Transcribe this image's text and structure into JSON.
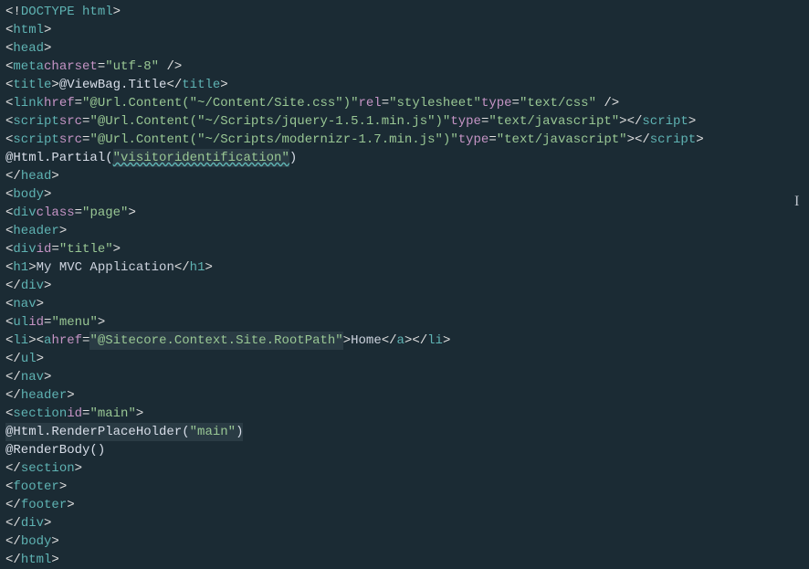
{
  "lines": {
    "l1": {
      "doctype": "<!DOCTYPE html>"
    },
    "l2": {
      "open_html": "<html>"
    },
    "l3": {
      "open_head": "<head>"
    },
    "l4": {
      "meta_open": "<",
      "meta_tag": "meta",
      "meta_sp": " ",
      "charset_attr": "charset",
      "eq": "=",
      "charset_val": "\"utf-8\"",
      "meta_close": " />"
    },
    "l5": {
      "title_open": "<",
      "title_tag": "title",
      "gt": ">",
      "razor": "@ViewBag.Title",
      "close_open": "</",
      "close_tag": "title",
      "close_gt": ">"
    },
    "l6": {
      "open": "<",
      "tag": "link",
      "sp": " ",
      "href_attr": "href",
      "eq1": "=",
      "href_val": "\"@Url.Content(\"~/Content/Site.css\")\"",
      "sp2": " ",
      "rel_attr": "rel",
      "eq2": "=",
      "rel_val": "\"stylesheet\"",
      "sp3": " ",
      "type_attr": "type",
      "eq3": "=",
      "type_val": "\"text/css\"",
      "close": " />"
    },
    "l7": {
      "open": "<",
      "tag": "script",
      "sp": " ",
      "src_attr": "src",
      "eq1": "=",
      "src_val": "\"@Url.Content(\"~/Scripts/jquery-1.5.1.min.js\")\"",
      "sp2": " ",
      "type_attr": "type",
      "eq2": "=",
      "type_val": "\"text/javascript\"",
      "gt": ">",
      "close_open": "</",
      "close_tag": "script",
      "close_gt": ">"
    },
    "l8": {
      "open": "<",
      "tag": "script",
      "sp": " ",
      "src_attr": "src",
      "eq1": "=",
      "src_val": "\"@Url.Content(\"~/Scripts/modernizr-1.7.min.js\")\"",
      "sp2": " ",
      "type_attr": "type",
      "eq2": "=",
      "type_val": "\"text/javascript\"",
      "gt": ">",
      "close_open": "</",
      "close_tag": "script",
      "close_gt": ">"
    },
    "l9": {
      "razor_pre": "@Html.Partial(",
      "str": "\"visitoridentification\"",
      "razor_post": ")"
    },
    "l10": {
      "close_head": "</head>"
    },
    "l11": {
      "open_body": "<body>"
    },
    "l12": {
      "open": "<",
      "tag": "div",
      "sp": " ",
      "class_attr": "class",
      "eq": "=",
      "class_val": "\"page\"",
      "gt": ">"
    },
    "l13": {
      "open": "<",
      "tag": "header",
      "gt": ">"
    },
    "l14": {
      "open": "<",
      "tag": "div",
      "sp": " ",
      "id_attr": "id",
      "eq": "=",
      "id_val": "\"title\"",
      "gt": ">"
    },
    "l15": {
      "open": "<",
      "tag": "h1",
      "gt": ">",
      "txt": "My MVC Application",
      "close_open": "</",
      "close_tag": "h1",
      "close_gt": ">"
    },
    "l16": {
      "close_open": "</",
      "tag": "div",
      "gt": ">"
    },
    "l17": {
      "open": "<",
      "tag": "nav",
      "gt": ">"
    },
    "l18": {
      "open": "<",
      "tag": "ul",
      "sp": " ",
      "id_attr": "id",
      "eq": "=",
      "id_val": "\"menu\"",
      "gt": ">"
    },
    "l19": {
      "open": "<",
      "tag_li": "li",
      "gt1": ">",
      "open2": "<",
      "tag_a": "a",
      "sp": " ",
      "href_attr": "href",
      "eq": "=",
      "href_val": "\"@Sitecore.Context.Site.RootPath\"",
      "gt2": ">",
      "txt": "Home",
      "close_a_open": "</",
      "close_a": "a",
      "close_a_gt": ">",
      "close_li_open": "</",
      "close_li": "li",
      "close_li_gt": ">"
    },
    "l20": {
      "close_open": "</",
      "tag": "ul",
      "gt": ">"
    },
    "l21": {
      "close_open": "</",
      "tag": "nav",
      "gt": ">"
    },
    "l22": {
      "close_open": "</",
      "tag": "header",
      "gt": ">"
    },
    "l23": {
      "open": "<",
      "tag": "section",
      "sp": " ",
      "id_attr": "id",
      "eq": "=",
      "id_val": "\"main\"",
      "gt": ">"
    },
    "l24": {
      "razor_pre": "@Html.RenderPlaceHolder(",
      "str": "\"main\"",
      "razor_post": ")"
    },
    "l25": {
      "razor": "@RenderBody()"
    },
    "l26": {
      "close_open": "</",
      "tag": "section",
      "gt": ">"
    },
    "l27": {
      "open": "<",
      "tag": "footer",
      "gt": ">"
    },
    "l28": {
      "close_open": "</",
      "tag": "footer",
      "gt": ">"
    },
    "l29": {
      "close_open": "</",
      "tag": "div",
      "gt": ">"
    },
    "l30": {
      "close_body": "</body>"
    },
    "l31": {
      "close_html": "</html>"
    }
  }
}
